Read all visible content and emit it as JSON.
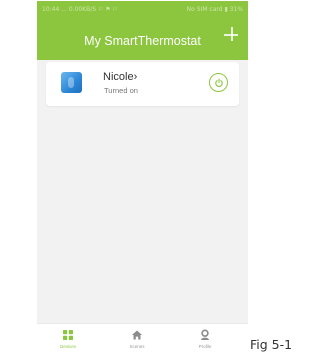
{
  "status_bar": {
    "left_text": "10:44 ... 0.00KB/S ⚐ ⚑ ⚐",
    "right_text": "No SIM card ▮ 31%"
  },
  "header": {
    "title": "My SmartThermostat",
    "add_icon": "plus-icon"
  },
  "devices": [
    {
      "name": "Nicole›",
      "status": "Turned on",
      "thumbnail_icon": "thermostat-icon",
      "power_icon": "power-icon"
    }
  ],
  "tabbar": {
    "tabs": [
      {
        "label": "Devices",
        "icon": "grid-icon",
        "active": true
      },
      {
        "label": "Scenes",
        "icon": "home-icon",
        "active": false
      },
      {
        "label": "Profile",
        "icon": "person-icon",
        "active": false
      }
    ]
  },
  "figure_caption": "Fig 5-1",
  "colors": {
    "accent": "#8cc63f",
    "background": "#f2f2f2",
    "card": "#ffffff",
    "device_blue": "#2c86d6"
  }
}
